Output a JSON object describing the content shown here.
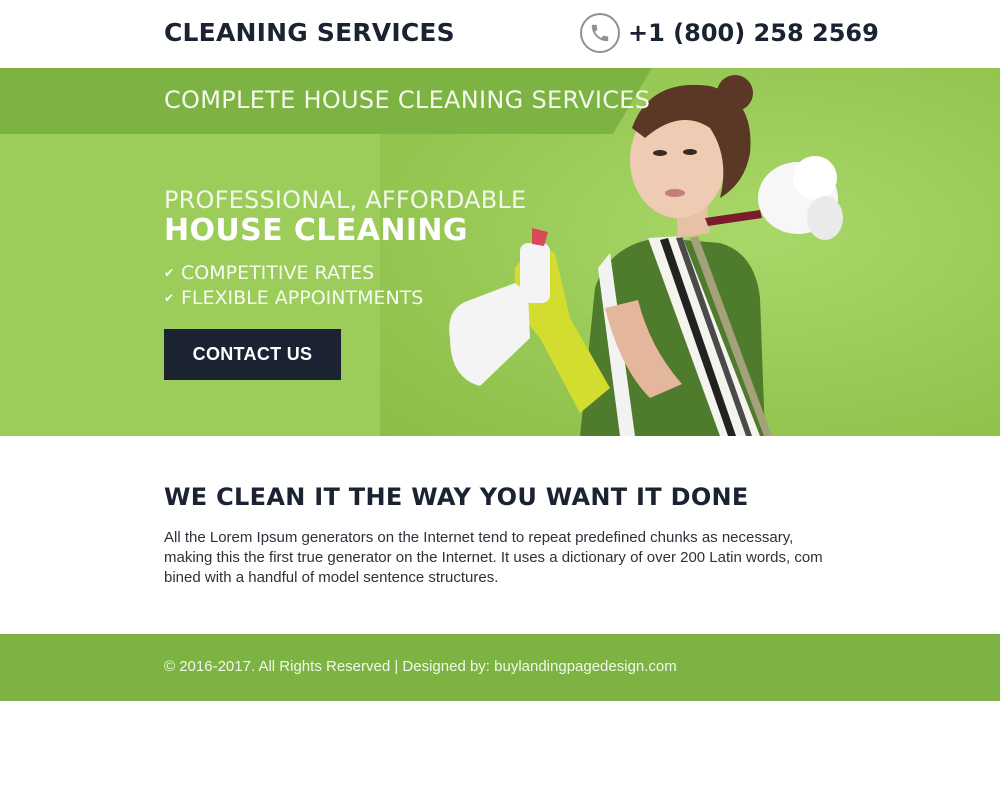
{
  "header": {
    "brand": "CLEANING SERVICES",
    "phone": "+1 (800) 258 2569",
    "phone_icon": "phone-icon"
  },
  "hero": {
    "banner": "COMPLETE HOUSE CLEANING SERVICES",
    "tagline": "PROFESSIONAL, AFFORDABLE",
    "headline": "HOUSE CLEANING",
    "features": [
      "COMPETITIVE RATES",
      "FLEXIBLE APPOINTMENTS"
    ],
    "feature_icon": "check-icon",
    "cta_label": "CONTACT US"
  },
  "content": {
    "title": "WE CLEAN IT THE WAY YOU WANT IT DONE",
    "text": "All the Lorem Ipsum generators on the Internet tend to repeat predefined chunks as necessary, making this the first true generator on the Internet. It uses a dictionary of over 200 Latin words, com bined with a handful of model sentence structures."
  },
  "footer": {
    "text": "© 2016-2017. All Rights Reserved  |  Designed by: buylandingpagedesign.com"
  },
  "colors": {
    "brand_green": "#7cb342",
    "hero_green": "#9ccc5a",
    "dark_navy": "#1b2231",
    "white": "#ffffff"
  }
}
